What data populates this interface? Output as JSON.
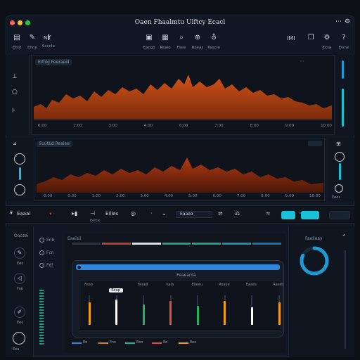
{
  "window": {
    "title": "Oaen Fhaalmtu Ulftcy Ecacl",
    "traffic_lights": [
      "#ff5f57",
      "#febc2e",
      "#28c840"
    ]
  },
  "toolbar": {
    "left": [
      {
        "icon": "folder-icon",
        "label": "Ehtd"
      },
      {
        "icon": "edit-icon",
        "label": "Enne"
      },
      {
        "icon": "ruler-icon",
        "label": "Sccnle"
      }
    ],
    "left_text": "Nff",
    "center": [
      {
        "icon": "image-icon",
        "label": "Eacgo"
      },
      {
        "icon": "grid-icon",
        "label": "Reaio"
      },
      {
        "icon": "search-icon",
        "label": "Fsee"
      },
      {
        "icon": "zoom-icon",
        "label": "Raeas"
      },
      {
        "icon": "brush-icon",
        "label": "Taecre"
      }
    ],
    "right_text": "IMI",
    "right": [
      {
        "icon": "copy-icon",
        "label": ""
      },
      {
        "icon": "settings-icon",
        "label": "Ecsa"
      },
      {
        "icon": "help-icon",
        "label": "Elsne"
      }
    ]
  },
  "top_panel": {
    "label": "Eifnlg Feeraeel",
    "ticks": [
      "0:00",
      "2:00",
      "3:00",
      "4:00",
      "6:00",
      "7:00",
      "8:00",
      "9:00",
      "10:00"
    ]
  },
  "mid_panel": {
    "label": "Fuutbd Reaiee",
    "ticks": [
      "0:00",
      "0:00",
      "1:00",
      "2:00",
      "3:00",
      "4:00",
      "5:00",
      "6:00",
      "7:00",
      "8:00",
      "9:00",
      "10:00"
    ],
    "right_label": "Eoos"
  },
  "transport": {
    "left_label": "Eaaal",
    "mode_label": "Eilles",
    "field_label": "Eaaeo",
    "sub_label": "Eerce"
  },
  "lower_left": {
    "label": "Oocsei",
    "items": [
      "Eoo",
      "Foo",
      "Eoo"
    ],
    "radios": [
      "Enb",
      "Fcn",
      "Fdl"
    ]
  },
  "mixer": {
    "label": "Eaeisil",
    "bar_colors": [
      "#2a3444",
      "#c0392b",
      "#d8e2ee",
      "#1aa08a",
      "#1aa08a",
      "#1a8fb0",
      "#1a6fb8"
    ],
    "popup_title": "Feaearda",
    "channels": [
      {
        "name": "Feao",
        "color": "#f39c12",
        "level": 0.75
      },
      {
        "name": "Reap",
        "color": "#ffffff",
        "level": 0.85
      },
      {
        "name": "Feaaa",
        "color": "#27ae60",
        "level": 0.7
      },
      {
        "name": "Kala",
        "color": "#e74c3c",
        "level": 0.8
      },
      {
        "name": "Eaeeu",
        "color": "#27ae60",
        "level": 0.65
      },
      {
        "name": "Reaue",
        "color": "#f39c12",
        "level": 0.8
      },
      {
        "name": "Eaaes",
        "color": "#ffffff",
        "level": 0.6
      },
      {
        "name": "Raees",
        "color": "#f39c12",
        "level": 0.75
      }
    ],
    "legend": [
      {
        "name": "Eo",
        "color": "#2e86de"
      },
      {
        "name": "Fnn",
        "color": "#e67e22"
      },
      {
        "name": "Eoo",
        "color": "#1abc9c"
      },
      {
        "name": "Eo",
        "color": "#e74c3c"
      },
      {
        "name": "Eeo",
        "color": "#f39c12"
      }
    ]
  },
  "progress": {
    "label": "Faelleay",
    "value": 0.82,
    "color": "#1e9ad6"
  }
}
